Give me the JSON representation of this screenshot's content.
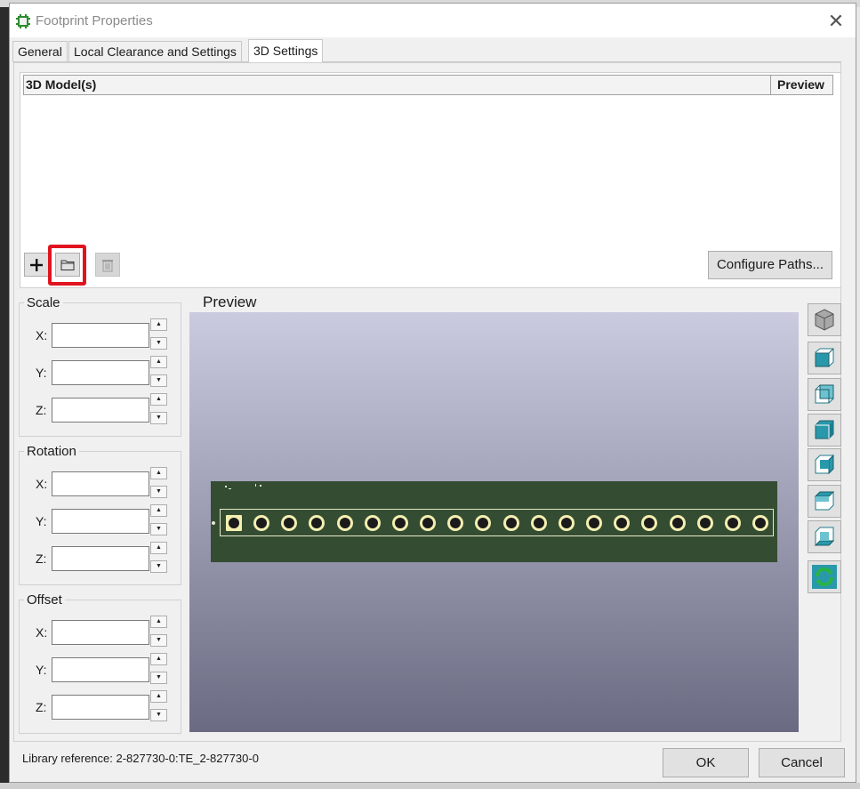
{
  "window": {
    "title": "Footprint Properties",
    "close_label": "✕"
  },
  "tabs": [
    {
      "label": "General",
      "active": false
    },
    {
      "label": "Local Clearance and Settings",
      "active": false
    },
    {
      "label": "3D Settings",
      "active": true
    }
  ],
  "models_grid": {
    "col_model": "3D Model(s)",
    "col_preview": "Preview",
    "rows": []
  },
  "toolbar": {
    "add_icon": "plus-icon",
    "browse_icon": "folder-icon",
    "delete_icon": "trash-icon",
    "configure_label": "Configure Paths..."
  },
  "scale": {
    "title": "Scale",
    "x_label": "X:",
    "y_label": "Y:",
    "z_label": "Z:",
    "x": "",
    "y": "",
    "z": ""
  },
  "rotation": {
    "title": "Rotation",
    "x_label": "X:",
    "y_label": "Y:",
    "z_label": "Z:",
    "x": "",
    "y": "",
    "z": ""
  },
  "offset": {
    "title": "Offset",
    "x_label": "X:",
    "y_label": "Y:",
    "z_label": "Z:",
    "x": "",
    "y": "",
    "z": ""
  },
  "preview": {
    "label": "Preview",
    "pad_count": 20,
    "view_buttons": [
      "cube-3d-icon",
      "view-front-icon",
      "view-back-icon",
      "view-left-icon",
      "view-right-icon",
      "view-top-icon",
      "view-bottom-icon",
      "reload-icon"
    ]
  },
  "footer": {
    "library_reference": "Library reference: 2-827730-0:TE_2-827730-0",
    "ok_label": "OK",
    "cancel_label": "Cancel"
  },
  "colors": {
    "highlight": "#e0141e",
    "pcb": "#344d32",
    "pad": "#f3efb0"
  }
}
